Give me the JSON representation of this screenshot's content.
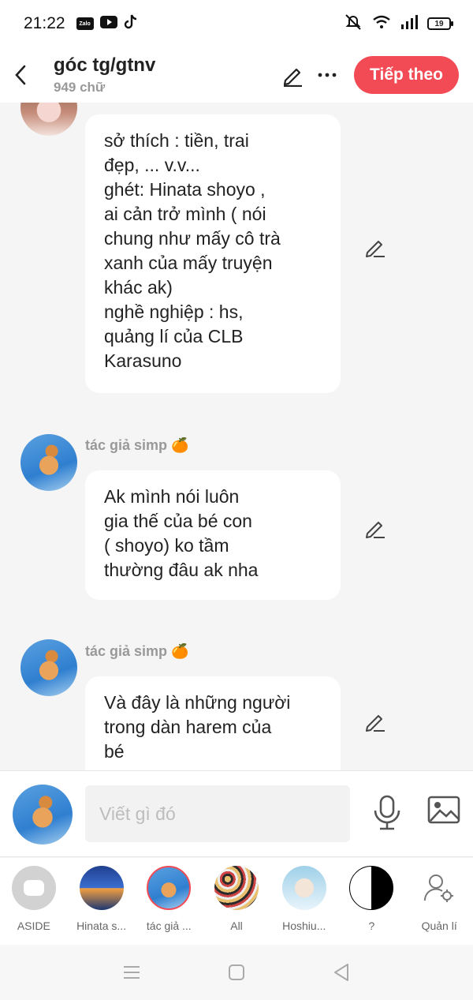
{
  "status": {
    "time": "21:22",
    "apps": [
      "Zalo",
      "YouTube",
      "TikTok"
    ],
    "battery": "19"
  },
  "header": {
    "title": "góc tg/gtnv",
    "subtitle": "949 chữ",
    "next_label": "Tiếp theo"
  },
  "messages": [
    {
      "author": "",
      "text": "sở thích : tiền, trai\nđẹp, ... v.v...\nghét: Hinata shoyo ,\nai cản trở mình ( nói\nchung như mấy cô trà\nxanh của mấy truyện\nkhác ak)\nnghề nghiệp : hs,\nquảng lí của CLB\nKarasuno"
    },
    {
      "author": "tác giả simp 🍊",
      "text": "Ak mình nói luôn\ngia thế của bé con\n( shoyo) ko tầm\nthường đâu ak nha"
    },
    {
      "author": "tác giả simp 🍊",
      "text": "Và đây là những người\ntrong dàn harem của\nbé"
    }
  ],
  "compose": {
    "placeholder": "Viết gì đó"
  },
  "characters": [
    {
      "label": "ASIDE"
    },
    {
      "label": "Hinata s..."
    },
    {
      "label": "tác giả ..."
    },
    {
      "label": "All"
    },
    {
      "label": "Hoshiu..."
    },
    {
      "label": "?"
    },
    {
      "label": "Quản lí"
    }
  ],
  "colors": {
    "accent": "#f24b55",
    "bubble": "#ffffff",
    "background": "#f5f5f5"
  }
}
